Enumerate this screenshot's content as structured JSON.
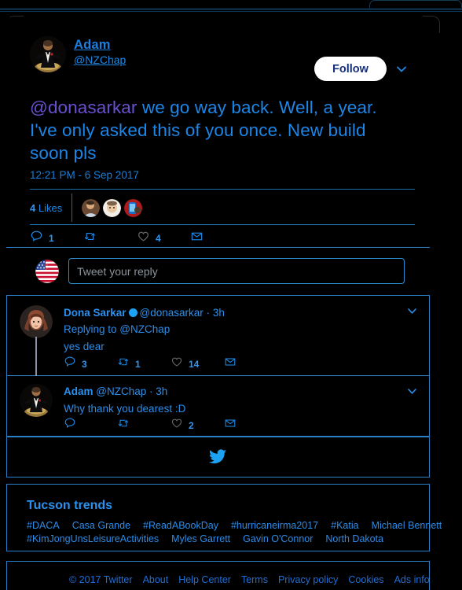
{
  "colors": {
    "background": "#000000",
    "card_border": "#2b7fc4",
    "link_blue": "#2b8ce8",
    "accent_blue": "#1b86e8",
    "mention_purple": "#6a4fd0",
    "follow_bg": "#ffffff",
    "follow_text": "#16307c",
    "verified_badge": "#1da1f2",
    "divider": "#1d6fa8"
  },
  "tweet": {
    "author_name": "Adam ",
    "author_handle": "@NZChap",
    "follow_label": "Follow",
    "caret_icon": "chevron-down-icon",
    "text_mention": "@donasarkar",
    "text_rest": " we go way back. Well, a year. I've only asked this of you once. New build soon pls",
    "timestamp": "12:21 PM - 6 Sep 2017",
    "likes_count": "4",
    "likes_label": "Likes",
    "actions": [
      {
        "icon": "reply-icon",
        "count": "1"
      },
      {
        "icon": "retweet-icon",
        "count": ""
      },
      {
        "icon": "like-heart-icon",
        "count": "4"
      },
      {
        "icon": "direct-message-icon",
        "count": ""
      }
    ]
  },
  "compose": {
    "avatar_icon": "usa-flag-avatar",
    "placeholder": "Tweet your reply"
  },
  "replies": [
    {
      "name": "Dona Sarkar",
      "verified": true,
      "handle": "@donasarkar",
      "separator": "·",
      "time": "3h",
      "replying_to": "Replying to @NZChap",
      "text": "yes dear",
      "caret_icon": "chevron-down-icon",
      "actions": [
        {
          "icon": "reply-icon",
          "count": "3"
        },
        {
          "icon": "retweet-icon",
          "count": "1"
        },
        {
          "icon": "like-heart-icon",
          "count": "14"
        },
        {
          "icon": "direct-message-icon",
          "count": ""
        }
      ]
    },
    {
      "name": "Adam",
      "verified": false,
      "handle": "@NZChap",
      "separator": "·",
      "time": "3h",
      "replying_to": "",
      "text": "Why thank you dearest :D",
      "caret_icon": "chevron-down-icon",
      "actions": [
        {
          "icon": "reply-icon",
          "count": ""
        },
        {
          "icon": "retweet-icon",
          "count": ""
        },
        {
          "icon": "like-heart-icon",
          "count": "2"
        },
        {
          "icon": "direct-message-icon",
          "count": ""
        }
      ]
    }
  ],
  "bird": {
    "icon": "twitter-bird-logo"
  },
  "trends": {
    "title": "Tucson trends",
    "row1": [
      "#DACA",
      "Casa Grande",
      "#ReadABookDay",
      "#hurricaneirma2017",
      "#Katia",
      "Michael Bennett"
    ],
    "row2": [
      "#KimJongUnsLeisureActivities",
      "Myles Garrett",
      "Gavin O'Connor",
      "North Dakota"
    ]
  },
  "footer": {
    "links": [
      "© 2017 Twitter",
      "About",
      "Help Center",
      "Terms",
      "Privacy policy",
      "Cookies",
      "Ads info"
    ]
  }
}
